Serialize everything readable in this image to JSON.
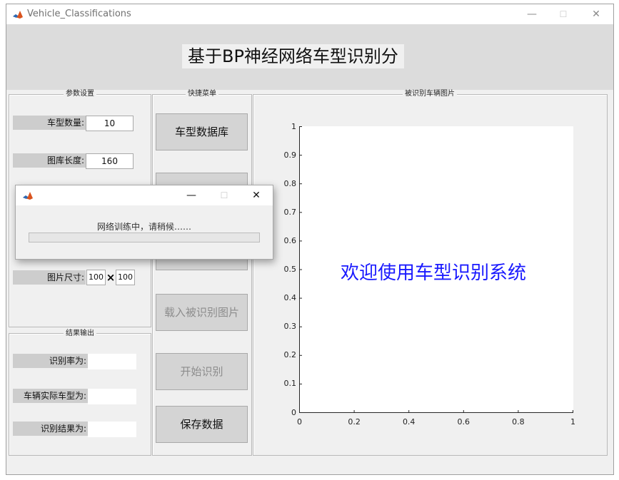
{
  "window": {
    "title": "Vehicle_Classifications",
    "controls": {
      "minimize": "—",
      "maximize": "☐",
      "close": "✕"
    }
  },
  "header": {
    "title": "基于BP神经网络车型识别分"
  },
  "params_panel": {
    "title": "参数设置",
    "num_types_label": "车型数量:",
    "num_types_value": "10",
    "lib_length_label": "图库长度:",
    "lib_length_value": "160",
    "img_size_label": "图片尺寸:",
    "img_width_value": "100",
    "img_times": "×",
    "img_height_value": "100"
  },
  "results_panel": {
    "title": "结果输出",
    "rate_label": "识别率为:",
    "rate_value": "",
    "actual_label": "车辆实际车型为:",
    "actual_value": "",
    "result_label": "识别结果为:",
    "result_value": ""
  },
  "menu_panel": {
    "title": "快捷菜单",
    "btn_database": "车型数据库",
    "btn_load_image": "载入被识别图片",
    "btn_start": "开始识别",
    "btn_save": "保存数据"
  },
  "image_panel": {
    "title": "被识别车辆图片",
    "welcome_text": "欢迎使用车型识别系统"
  },
  "chart_data": {
    "type": "line",
    "xlim": [
      0,
      1
    ],
    "ylim": [
      0,
      1
    ],
    "xticks": [
      "0",
      "0.2",
      "0.4",
      "0.6",
      "0.8",
      "1"
    ],
    "yticks": [
      "0",
      "0.1",
      "0.2",
      "0.3",
      "0.4",
      "0.5",
      "0.6",
      "0.7",
      "0.8",
      "0.9",
      "1"
    ],
    "series": []
  },
  "progress_dialog": {
    "message": "网络训练中，请稍候……",
    "progress": 0,
    "controls": {
      "minimize": "—",
      "maximize": "☐",
      "close": "✕"
    }
  },
  "colors": {
    "welcome_text": "#1a1aff",
    "progress_fill": "#06b025"
  }
}
